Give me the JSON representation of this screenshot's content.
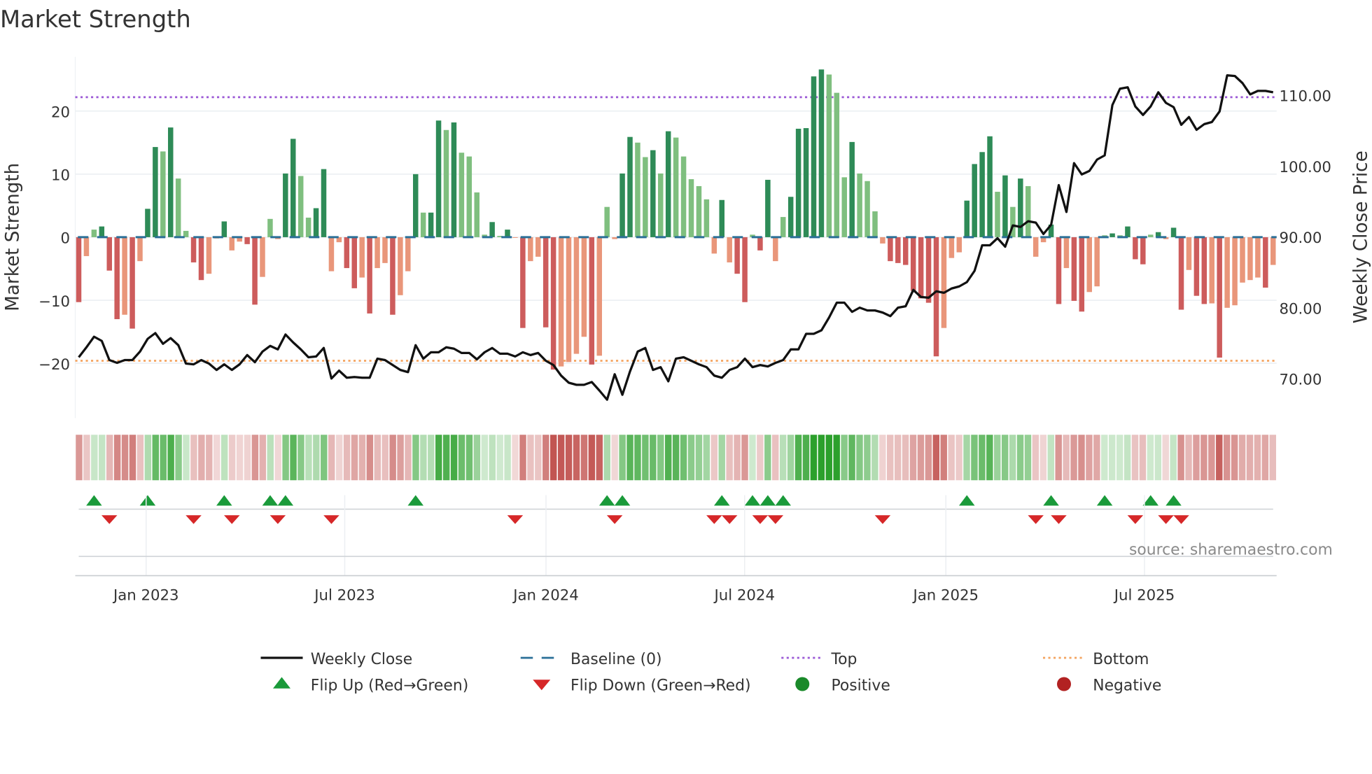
{
  "chart_data": {
    "type": "bar",
    "title": "Market Strength",
    "ylabel": "Market Strength",
    "y2label": "Weekly Close Price",
    "ylim": [
      -28.7,
      28.6
    ],
    "y2lim": [
      64.4,
      115.4
    ],
    "yticks": [
      "20",
      "10",
      "0",
      "−10",
      "−20"
    ],
    "yticks_values": [
      20,
      10,
      0,
      -10,
      -20
    ],
    "y2ticks": [
      "110.00",
      "100.00",
      "90.00",
      "80.00",
      "70.00"
    ],
    "y2ticks_values": [
      110,
      100,
      90,
      80,
      70
    ],
    "xticks": [
      "Jan 2023",
      "Jul 2023",
      "Jan 2024",
      "Jul 2024",
      "Jan 2025",
      "Jul 2025"
    ],
    "top_level": 22.2,
    "bottom_level": -19.6,
    "baseline": 0,
    "grid": true,
    "legend_placement": "bottom",
    "source": "source: sharemaestro.com",
    "colors": {
      "strong_pos": "#2e8b57",
      "weak_pos": "#7fbf7f",
      "strong_neg": "#cd5c5c",
      "weak_neg": "#e9967a",
      "close": "#111111",
      "baseline": "#2a6f97",
      "top": "#9b59d6",
      "bottom": "#f4a460",
      "flip_up": "#1a9a3a",
      "flip_down": "#d62728"
    },
    "strength": [
      -10.3,
      -3,
      1.2,
      1.7,
      -5.3,
      -13,
      -12.3,
      -14.5,
      -3.8,
      4.5,
      14.3,
      13.6,
      17.4,
      9.3,
      1,
      -4,
      -6.8,
      -5.8,
      -0.2,
      2.5,
      -2.1,
      -0.7,
      -1.1,
      -10.7,
      -6.3,
      2.9,
      -0.3,
      10.1,
      15.6,
      9.7,
      3.1,
      4.6,
      10.8,
      -5.4,
      -0.8,
      -4.9,
      -8.1,
      -6.4,
      -12.1,
      -4.9,
      -4.1,
      -12.3,
      -9.2,
      -5.4,
      10,
      3.9,
      3.9,
      18.5,
      17,
      18.2,
      13.4,
      12.8,
      7.1,
      0.4,
      2.4,
      0.2,
      1.2,
      -0.1,
      -14.4,
      -3.8,
      -3.1,
      -14.3,
      -21,
      -20.5,
      -19.8,
      -18.5,
      -15.8,
      -20.2,
      -18.8,
      4.8,
      -0.3,
      10.1,
      15.9,
      15,
      12.7,
      13.8,
      10.1,
      16.8,
      15.8,
      12.8,
      9.2,
      8.1,
      6,
      -2.6,
      5.9,
      -4,
      -5.8,
      -10.3,
      0.4,
      -2.1,
      9.1,
      -3.8,
      3.2,
      6.4,
      17.2,
      17.3,
      25.5,
      26.6,
      25.8,
      22.9,
      9.5,
      15.1,
      10.1,
      8.9,
      4.1,
      -1,
      -3.8,
      -4.1,
      -4.4,
      -8.5,
      -9.7,
      -10.4,
      -18.9,
      -14.4,
      -3.3,
      -2.4,
      5.8,
      11.6,
      13.5,
      16,
      7.2,
      9.8,
      4.8,
      9.3,
      8.1,
      -3.1,
      -0.8,
      2,
      -10.6,
      -4.9,
      -10.1,
      -11.8,
      -8.7,
      -7.8,
      0.3,
      0.6,
      0.3,
      1.7,
      -3.5,
      -4.3,
      0.4,
      0.8,
      -0.3,
      1.5,
      -11.5,
      -5.2,
      -9.3,
      -10.6,
      -10.5,
      -19.1,
      -11.2,
      -10.8,
      -7.2,
      -6.8,
      -6.4,
      -8,
      -4.4
    ],
    "weekly_close": [
      73.0,
      74.4,
      75.9,
      75.3,
      72.6,
      72.2,
      72.6,
      72.6,
      73.8,
      75.6,
      76.4,
      74.9,
      75.7,
      74.7,
      72.1,
      72.0,
      72.6,
      72.1,
      71.2,
      72.0,
      71.2,
      72.0,
      73.3,
      72.3,
      73.8,
      74.6,
      74.1,
      76.2,
      75.1,
      74.1,
      73.0,
      73.1,
      74.3,
      70.0,
      71.1,
      70.1,
      70.2,
      70.1,
      70.1,
      72.8,
      72.6,
      71.9,
      71.2,
      70.9,
      74.7,
      72.8,
      73.7,
      73.7,
      74.4,
      74.2,
      73.6,
      73.6,
      72.7,
      73.7,
      74.3,
      73.5,
      73.5,
      73.1,
      73.7,
      73.3,
      73.6,
      72.5,
      71.9,
      70.4,
      69.4,
      69.1,
      69.1,
      69.5,
      68.3,
      67.0,
      70.6,
      67.7,
      71.0,
      73.8,
      74.3,
      71.2,
      71.6,
      69.6,
      72.8,
      73.0,
      72.5,
      72.0,
      71.6,
      70.4,
      70.1,
      71.2,
      71.6,
      72.8,
      71.6,
      71.9,
      71.7,
      72.2,
      72.6,
      74.1,
      74.1,
      76.3,
      76.3,
      76.8,
      78.6,
      80.7,
      80.7,
      79.4,
      80.0,
      79.6,
      79.6,
      79.3,
      78.8,
      80.0,
      80.2,
      82.5,
      81.5,
      81.4,
      82.3,
      82.1,
      82.7,
      83.0,
      83.6,
      85.2,
      88.8,
      88.8,
      89.8,
      88.6,
      91.6,
      91.4,
      92.2,
      92.0,
      90.4,
      91.7,
      97.3,
      93.5,
      100.4,
      98.8,
      99.3,
      100.9,
      101.5,
      108.6,
      110.9,
      111.1,
      108.4,
      107.2,
      108.4,
      110.4,
      108.9,
      108.3,
      105.8,
      106.9,
      105.1,
      105.9,
      106.2,
      107.7,
      112.8,
      112.7,
      111.7,
      110.1,
      110.6,
      110.6,
      110.4
    ],
    "flip_up_weeks": [
      2,
      9,
      19,
      25,
      27,
      44,
      69,
      71,
      84,
      88,
      90,
      92,
      116,
      127,
      134,
      140,
      143
    ],
    "flip_down_weeks": [
      4,
      15,
      20,
      26,
      33,
      57,
      70,
      83,
      85,
      89,
      91,
      105,
      125,
      128,
      138,
      142,
      144
    ],
    "legend": [
      {
        "label": "Weekly Close",
        "symbol": "line"
      },
      {
        "label": "Baseline (0)",
        "symbol": "dash"
      },
      {
        "label": "Top",
        "symbol": "dot-purple"
      },
      {
        "label": "Bottom",
        "symbol": "dot-orange"
      },
      {
        "label": "Flip Up (Red→Green)",
        "symbol": "tri-up"
      },
      {
        "label": "Flip Down (Green→Red)",
        "symbol": "tri-down"
      },
      {
        "label": "Positive",
        "symbol": "circle-green"
      },
      {
        "label": "Negative",
        "symbol": "circle-red"
      }
    ]
  }
}
